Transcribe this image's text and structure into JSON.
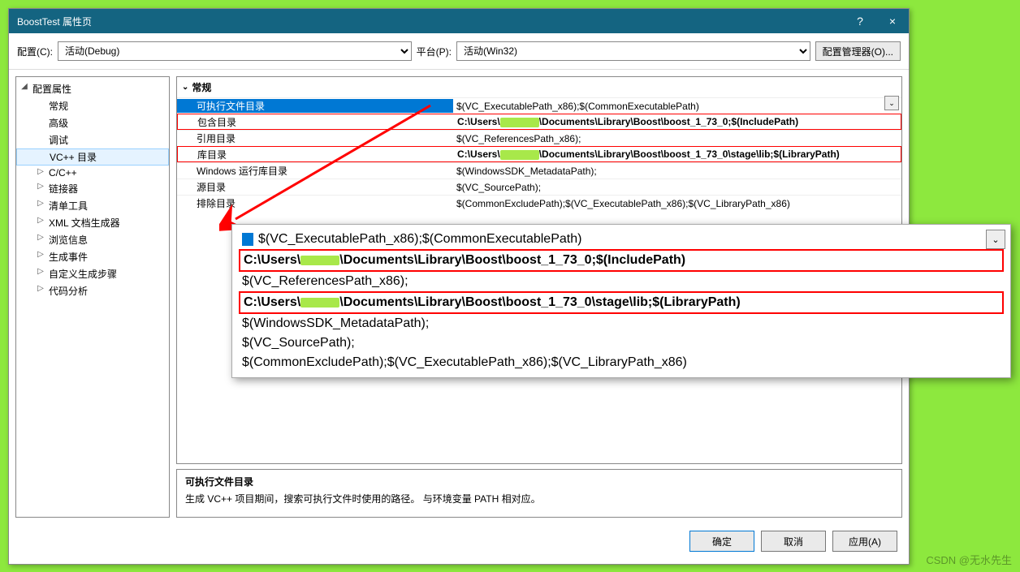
{
  "window": {
    "title": "BoostTest 属性页",
    "help_label": "?",
    "close_label": "×"
  },
  "config": {
    "label": "配置(C):",
    "value": "活动(Debug)"
  },
  "platform": {
    "label": "平台(P):",
    "value": "活动(Win32)"
  },
  "manager_button": "配置管理器(O)...",
  "tree": {
    "items": [
      {
        "label": "配置属性",
        "depth": 0,
        "arrow": "◢"
      },
      {
        "label": "常规",
        "depth": 1
      },
      {
        "label": "高级",
        "depth": 1
      },
      {
        "label": "调试",
        "depth": 1
      },
      {
        "label": "VC++ 目录",
        "depth": 1,
        "selected": true
      },
      {
        "label": "C/C++",
        "depth": 1,
        "arrow": "▷"
      },
      {
        "label": "链接器",
        "depth": 1,
        "arrow": "▷"
      },
      {
        "label": "清单工具",
        "depth": 1,
        "arrow": "▷"
      },
      {
        "label": "XML 文档生成器",
        "depth": 1,
        "arrow": "▷"
      },
      {
        "label": "浏览信息",
        "depth": 1,
        "arrow": "▷"
      },
      {
        "label": "生成事件",
        "depth": 1,
        "arrow": "▷"
      },
      {
        "label": "自定义生成步骤",
        "depth": 1,
        "arrow": "▷"
      },
      {
        "label": "代码分析",
        "depth": 1,
        "arrow": "▷"
      }
    ]
  },
  "group_label": "常规",
  "props": [
    {
      "name": "可执行文件目录",
      "value": "$(VC_ExecutablePath_x86);$(CommonExecutablePath)",
      "selected": true
    },
    {
      "name": "包含目录",
      "value_parts": [
        "C:\\Users\\",
        "\\Documents\\Library\\Boost\\boost_1_73_0;$(IncludePath)"
      ],
      "highlight": true
    },
    {
      "name": "引用目录",
      "value": "$(VC_ReferencesPath_x86);"
    },
    {
      "name": "库目录",
      "value_parts": [
        "C:\\Users\\",
        "\\Documents\\Library\\Boost\\boost_1_73_0\\stage\\lib;$(LibraryPath)"
      ],
      "highlight": true
    },
    {
      "name": "Windows 运行库目录",
      "value": "$(WindowsSDK_MetadataPath);"
    },
    {
      "name": "源目录",
      "value": "$(VC_SourcePath);"
    },
    {
      "name": "排除目录",
      "value": "$(CommonExcludePath);$(VC_ExecutablePath_x86);$(VC_LibraryPath_x86)"
    }
  ],
  "dropdown_icon": "⌄",
  "desc": {
    "title": "可执行文件目录",
    "text": "生成 VC++ 项目期间，搜索可执行文件时使用的路径。   与环境变量 PATH 相对应。"
  },
  "buttons": {
    "ok": "确定",
    "cancel": "取消",
    "apply": "应用(A)"
  },
  "zoom": {
    "lines": [
      {
        "text": "$(VC_ExecutablePath_x86);$(CommonExecutablePath)",
        "first": true
      },
      {
        "text_parts": [
          "C:\\Users\\",
          "\\Documents\\Library\\Boost\\boost_1_73_0;$(IncludePath)"
        ],
        "bold": true
      },
      {
        "text": "$(VC_ReferencesPath_x86);"
      },
      {
        "text_parts": [
          "C:\\Users\\",
          "\\Documents\\Library\\Boost\\boost_1_73_0\\stage\\lib;$(LibraryPath)"
        ],
        "bold": true
      },
      {
        "text": "$(WindowsSDK_MetadataPath);"
      },
      {
        "text": "$(VC_SourcePath);"
      },
      {
        "text": "$(CommonExcludePath);$(VC_ExecutablePath_x86);$(VC_LibraryPath_x86)"
      }
    ]
  },
  "watermark": "CSDN @无水先生"
}
